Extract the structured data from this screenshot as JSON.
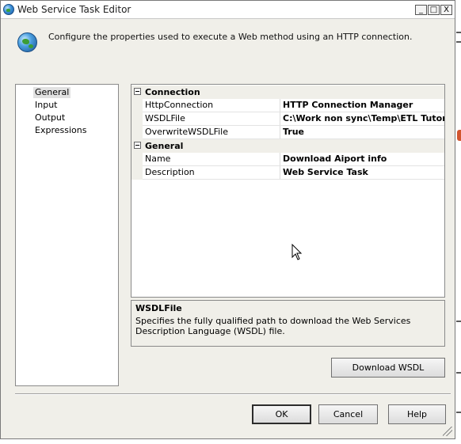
{
  "window": {
    "title": "Web Service Task Editor",
    "controls": {
      "minimize": "_",
      "maximize": "□",
      "close": "X"
    }
  },
  "header": {
    "icon": "globe-icon",
    "description": "Configure the properties used to execute a Web method using an HTTP connection."
  },
  "nav": {
    "items": [
      {
        "label": "General",
        "selected": true
      },
      {
        "label": "Input",
        "selected": false
      },
      {
        "label": "Output",
        "selected": false
      },
      {
        "label": "Expressions",
        "selected": false
      }
    ]
  },
  "properties": {
    "connection": {
      "label": "Connection",
      "rows": [
        {
          "name": "HttpConnection",
          "value": "HTTP Connection Manager"
        },
        {
          "name": "WSDLFile",
          "value": "C:\\Work non sync\\Temp\\ETL Tutor\\"
        },
        {
          "name": "OverwriteWSDLFile",
          "value": "True"
        }
      ]
    },
    "general": {
      "label": "General",
      "rows": [
        {
          "name": "Name",
          "value": "Download Aiport info"
        },
        {
          "name": "Description",
          "value": "Web Service Task"
        }
      ]
    }
  },
  "description_panel": {
    "title": "WSDLFile",
    "text": "Specifies the fully qualified path to download the Web Services Description Language (WSDL) file."
  },
  "buttons": {
    "download_wsdl": "Download WSDL",
    "ok": "OK",
    "cancel": "Cancel",
    "help": "Help"
  },
  "colors": {
    "dialog_bg": "#f0efe9",
    "panel_bg": "#ffffff",
    "border": "#8a8a8a"
  }
}
